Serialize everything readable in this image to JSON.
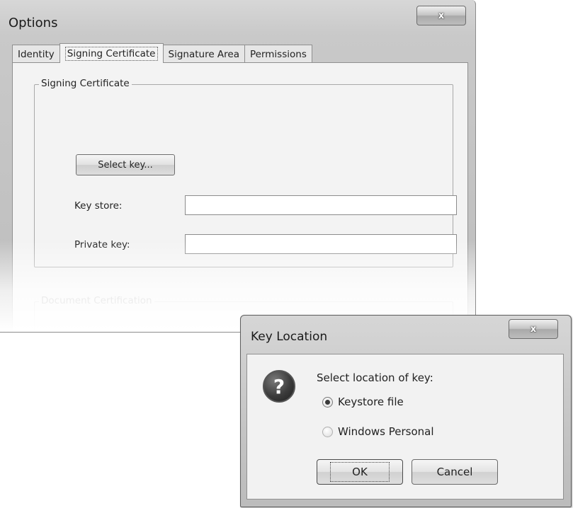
{
  "options_window": {
    "title": "Options",
    "close_glyph": "x",
    "tabs": [
      {
        "label": "Identity",
        "active": false
      },
      {
        "label": "Signing Certificate",
        "active": true
      },
      {
        "label": "Signature Area",
        "active": false
      },
      {
        "label": "Permissions",
        "active": false
      }
    ],
    "signing_group": {
      "legend": "Signing Certificate",
      "select_key_button": "Select key...",
      "key_store_label": "Key store:",
      "key_store_value": "",
      "private_key_label": "Private key:",
      "private_key_value": ""
    },
    "document_certification_group": {
      "legend": "Document Certification"
    }
  },
  "key_location_dialog": {
    "title": "Key Location",
    "close_glyph": "x",
    "icon": "question-icon",
    "icon_glyph": "?",
    "prompt": "Select location of key:",
    "options": [
      {
        "label": "Keystore file",
        "selected": true
      },
      {
        "label": "Windows Personal",
        "selected": false
      }
    ],
    "ok_button": "OK",
    "cancel_button": "Cancel"
  }
}
